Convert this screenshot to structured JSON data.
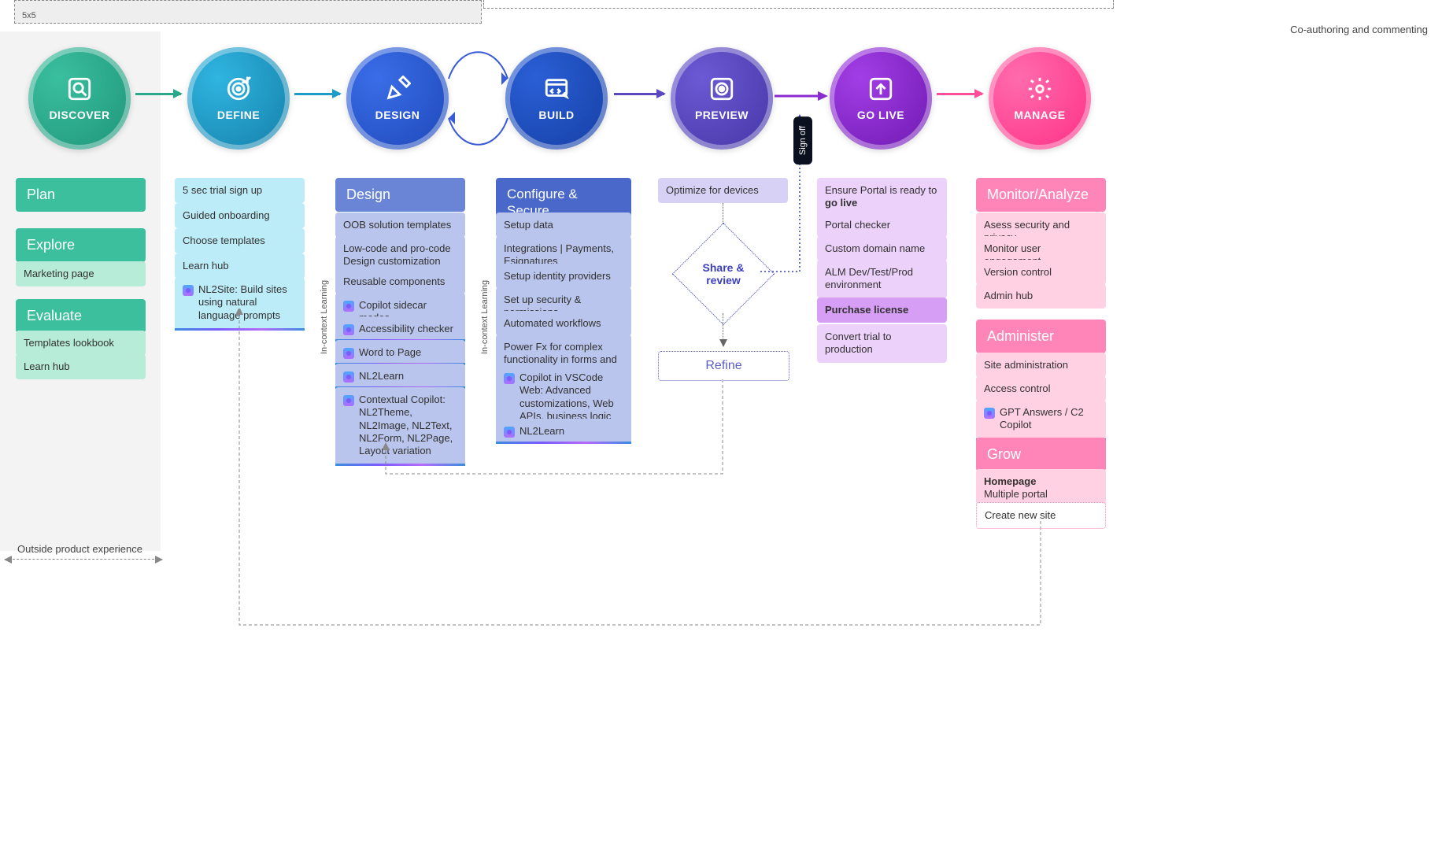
{
  "topbar": {
    "size_label": "5x5",
    "coauthoring": "Co-authoring and commenting"
  },
  "stages": {
    "discover": {
      "label": "DISCOVER",
      "color": "#2aa88a"
    },
    "define": {
      "label": "DEFINE",
      "color": "#1d9cc9"
    },
    "design": {
      "label": "DESIGN",
      "color": "#2a5bd7"
    },
    "build": {
      "label": "BUILD",
      "color": "#1c4fc4"
    },
    "preview": {
      "label": "PREVIEW",
      "color": "#5b48c1"
    },
    "golive": {
      "label": "GO LIVE",
      "color": "#8a2bd0"
    },
    "manage": {
      "label": "MANAGE",
      "color": "#ff4f9a"
    }
  },
  "arrows": {
    "a1": "#2aa88a",
    "a2": "#1d9cc9",
    "a5": "#5b48c1",
    "a6": "#8a2bd0",
    "a7": "#ff4f9a"
  },
  "discover": {
    "headers": {
      "plan": "Plan",
      "explore": "Explore",
      "evaluate": "Evaluate"
    },
    "explore_items": [
      "Marketing page"
    ],
    "evaluate_items": [
      "Templates lookbook",
      "Learn hub"
    ]
  },
  "define": {
    "items": [
      "5 sec trial sign up",
      "Guided onboarding",
      "Choose templates",
      "Learn hub"
    ],
    "ai": "NL2Site: Build sites using natural language prompts"
  },
  "design": {
    "header": "Design",
    "items": [
      "OOB solution templates",
      "Low-code and pro-code Design customization",
      "Reusable components"
    ],
    "ai": [
      "Copilot sidecar modes",
      "Accessibility checker",
      "Word to Page",
      "NL2Learn",
      "Contextual Copilot: NL2Theme, NL2Image, NL2Text, NL2Form, NL2Page, Layout variation"
    ],
    "sidelabel": "In-context Learning"
  },
  "build": {
    "header": "Configure & Secure",
    "items": [
      "Setup data",
      "Integrations | Payments, Esignatures",
      "Setup identity providers",
      "Set up security & permissions",
      "Automated workflows",
      "Power Fx for complex functionality in forms and lists"
    ],
    "ai": [
      "Copilot in VSCode Web: Advanced customizations, Web APIs, business logic and code summary",
      "NL2Learn"
    ],
    "sidelabel": "In-context Learning"
  },
  "preview": {
    "optimize": "Optimize for devices",
    "share": "Share & review",
    "refine": "Refine",
    "signoff": "Sign off"
  },
  "golive": {
    "ready_pre": "Ensure Portal is ready to ",
    "ready_bold": "go live",
    "items": [
      "Portal checker",
      "Custom domain name",
      "ALM Dev/Test/Prod environment"
    ],
    "purchase": "Purchase license",
    "convert": "Convert trial to production"
  },
  "manage": {
    "monitor_header": "Monitor/Analyze",
    "monitor_items": [
      "Asess security and privacy",
      "Monitor user engagement",
      "Version control",
      "Admin hub"
    ],
    "admin_header": "Administer",
    "admin_items": [
      "Site administration",
      "Access control"
    ],
    "admin_ai": "GPT Answers / C2 Copilot",
    "grow_header": "Grow",
    "grow_home_bold": "Homepage",
    "grow_home_rest": "Multiple portal management",
    "grow_create": "Create new site"
  },
  "footer": {
    "outside": "Outside product experience"
  }
}
